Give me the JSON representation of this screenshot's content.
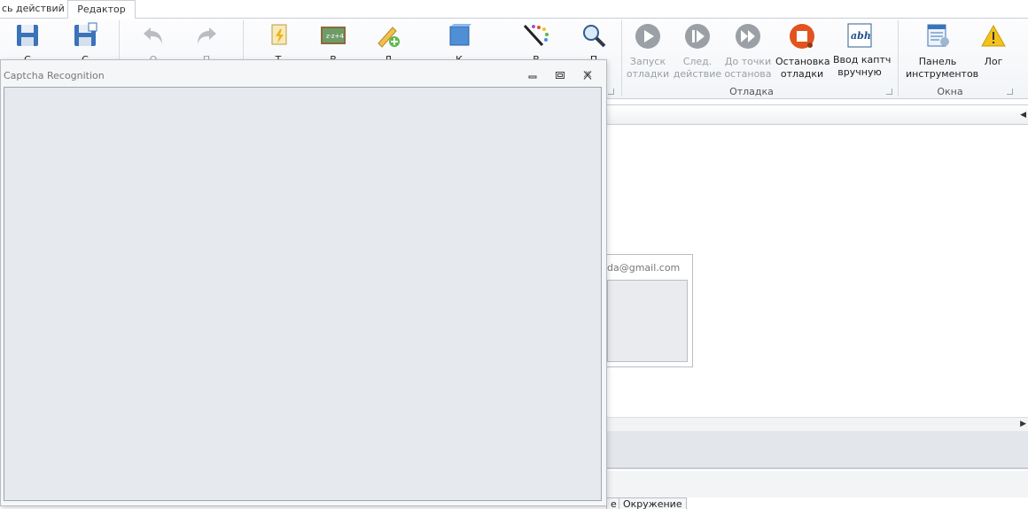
{
  "tabs": [
    {
      "label": "сь действий"
    },
    {
      "label": "Редактор"
    }
  ],
  "ribbon": {
    "buttons": [
      {
        "label": "С"
      },
      {
        "label": "С"
      },
      {
        "label": "О"
      },
      {
        "label": "П"
      },
      {
        "label": "Т"
      },
      {
        "label": "В"
      },
      {
        "label": "Д"
      },
      {
        "label": "К"
      },
      {
        "label": "В"
      },
      {
        "label": "П"
      },
      {
        "label_line1": "Запуск",
        "label_line2": "отладки"
      },
      {
        "label_line1": "След.",
        "label_line2": "действие"
      },
      {
        "label_line1": "До точки",
        "label_line2": "останова"
      },
      {
        "label_line1": "Остановка",
        "label_line2": "отладки"
      },
      {
        "label_line1": "Ввод каптч",
        "label_line2": "вручную"
      },
      {
        "label_line1": "Панель",
        "label_line2": "инструментов"
      },
      {
        "label_line1": "Лог",
        "label_line2": ""
      }
    ],
    "groups": {
      "debug": "Отладка",
      "windows": "Окна"
    }
  },
  "background": {
    "email_text": "da@gmail.com",
    "bottom_tab_1": "е",
    "bottom_tab_2": "Окружение"
  },
  "dialog": {
    "title": "Captcha Recognition"
  },
  "colors": {
    "accent": "#4a90d9",
    "stop_red": "#e2531f",
    "warning_yellow": "#f3c21b",
    "disabled_gray": "#9aa0a6"
  }
}
